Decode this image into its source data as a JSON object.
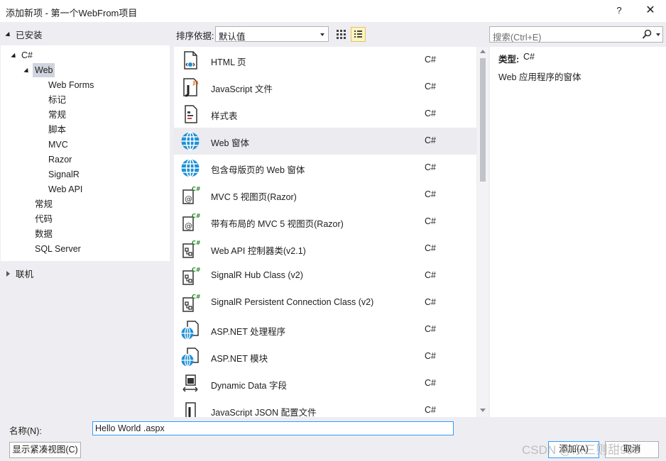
{
  "window": {
    "title": "添加新项 - 第一个WebFrom项目",
    "help_label": "?",
    "close_label": "✕"
  },
  "left_panel": {
    "header": "已安装",
    "tree": [
      {
        "label": "C#",
        "expanded": true
      },
      {
        "label": "Web",
        "expanded": true,
        "selected": true
      },
      {
        "label": "Web Forms"
      },
      {
        "label": "标记"
      },
      {
        "label": "常规"
      },
      {
        "label": "脚本"
      },
      {
        "label": "MVC"
      },
      {
        "label": "Razor"
      },
      {
        "label": "SignalR"
      },
      {
        "label": "Web API"
      },
      {
        "label": "常规"
      },
      {
        "label": "代码"
      },
      {
        "label": "数据"
      },
      {
        "label": "SQL Server"
      }
    ],
    "online_label": "联机"
  },
  "toolbar": {
    "sort_label": "排序依据:",
    "sort_value": "默认值",
    "search_placeholder": "搜索(Ctrl+E)"
  },
  "templates": [
    {
      "name": "HTML 页",
      "lang": "C#",
      "icon": "html-page-icon"
    },
    {
      "name": "JavaScript 文件",
      "lang": "C#",
      "icon": "javascript-file-icon"
    },
    {
      "name": "样式表",
      "lang": "C#",
      "icon": "stylesheet-icon"
    },
    {
      "name": "Web 窗体",
      "lang": "C#",
      "icon": "web-form-globe-icon",
      "selected": true
    },
    {
      "name": "包含母版页的 Web 窗体",
      "lang": "C#",
      "icon": "web-form-globe-icon"
    },
    {
      "name": "MVC 5 视图页(Razor)",
      "lang": "C#",
      "icon": "razor-view-icon"
    },
    {
      "name": "带有布局的 MVC 5 视图页(Razor)",
      "lang": "C#",
      "icon": "razor-view-icon"
    },
    {
      "name": "Web API 控制器类(v2.1)",
      "lang": "C#",
      "icon": "csharp-class-icon"
    },
    {
      "name": "SignalR Hub Class (v2)",
      "lang": "C#",
      "icon": "csharp-class-icon"
    },
    {
      "name": "SignalR Persistent Connection Class (v2)",
      "lang": "C#",
      "icon": "csharp-class-icon"
    },
    {
      "name": "ASP.NET 处理程序",
      "lang": "C#",
      "icon": "aspnet-globe-page-icon"
    },
    {
      "name": "ASP.NET 模块",
      "lang": "C#",
      "icon": "aspnet-globe-page-icon"
    },
    {
      "name": "Dynamic Data 字段",
      "lang": "C#",
      "icon": "dynamic-data-icon"
    },
    {
      "name": "JavaScript JSON 配置文件",
      "lang": "C#",
      "icon": "json-file-icon"
    }
  ],
  "details": {
    "type_label": "类型:",
    "type_value": "C#",
    "description": "Web 应用程序的窗体"
  },
  "bottom": {
    "name_label": "名称(N):",
    "name_value": "Hello World .aspx",
    "compact_view_button": "显示紧凑视图(C)",
    "add_button": "添加(A)",
    "cancel_button": "取消",
    "watermark": "CSDN @东三则甜995"
  },
  "colors": {
    "accent_blue": "#1e90d6",
    "selection_bg": "#ebebf0",
    "input_focus_border": "#3399ff"
  }
}
